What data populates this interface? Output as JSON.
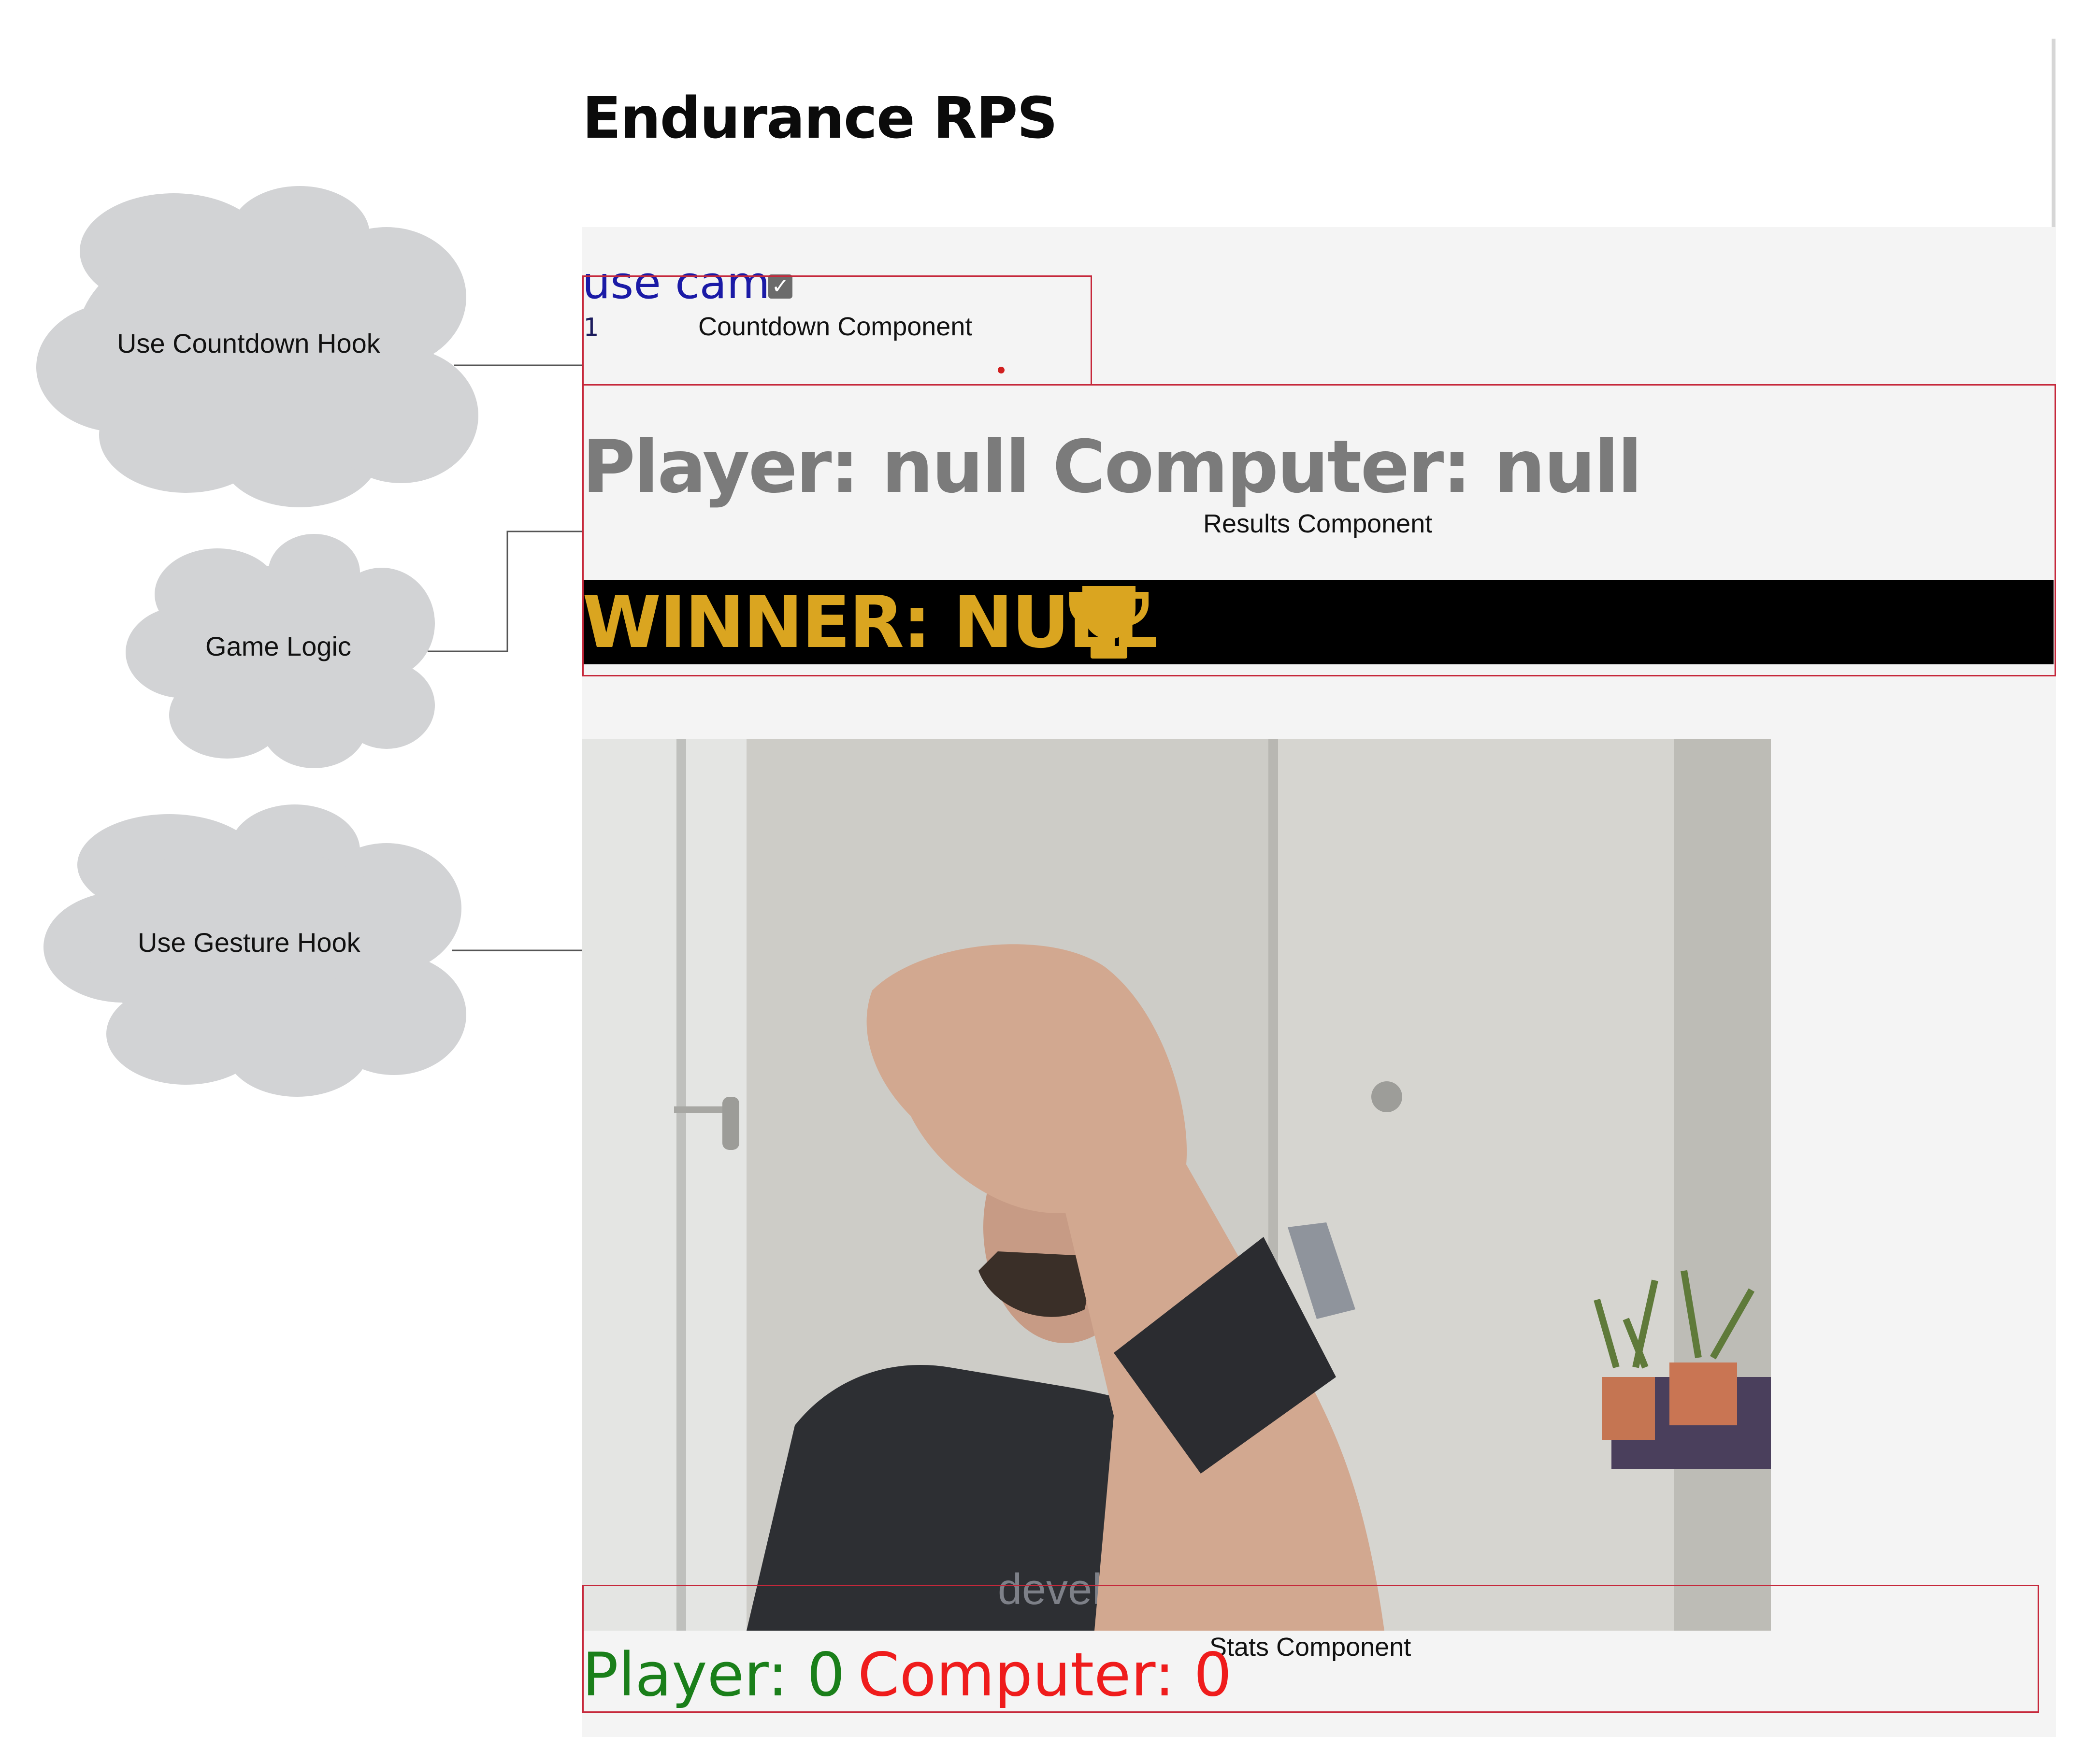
{
  "app": {
    "title": "Endurance RPS",
    "use_cam_label": "use cam",
    "use_cam_checked": true,
    "countdown_value": "1",
    "result_line": "Player: null Computer: null",
    "winner_line": "WINNER: NULL",
    "stats": {
      "player": "Player: 0",
      "computer": "Computer: 0"
    },
    "colors": {
      "winner_text": "#daa520",
      "player_stat": "#1a7f1a",
      "computer_stat": "#ef1c1c",
      "box_outline": "#c6283b",
      "cloud_fill": "#d2d3d5"
    }
  },
  "annotations": {
    "countdown_component": "Countdown Component",
    "results_component": "Results Component",
    "stats_component": "Stats Component"
  },
  "clouds": {
    "countdown_hook": "Use Countdown Hook",
    "game_logic": "Game Logic",
    "gesture_hook": "Use Gesture Hook"
  },
  "icons": {
    "trophy": "trophy-icon",
    "checkbox": "checkbox-checked-icon"
  }
}
